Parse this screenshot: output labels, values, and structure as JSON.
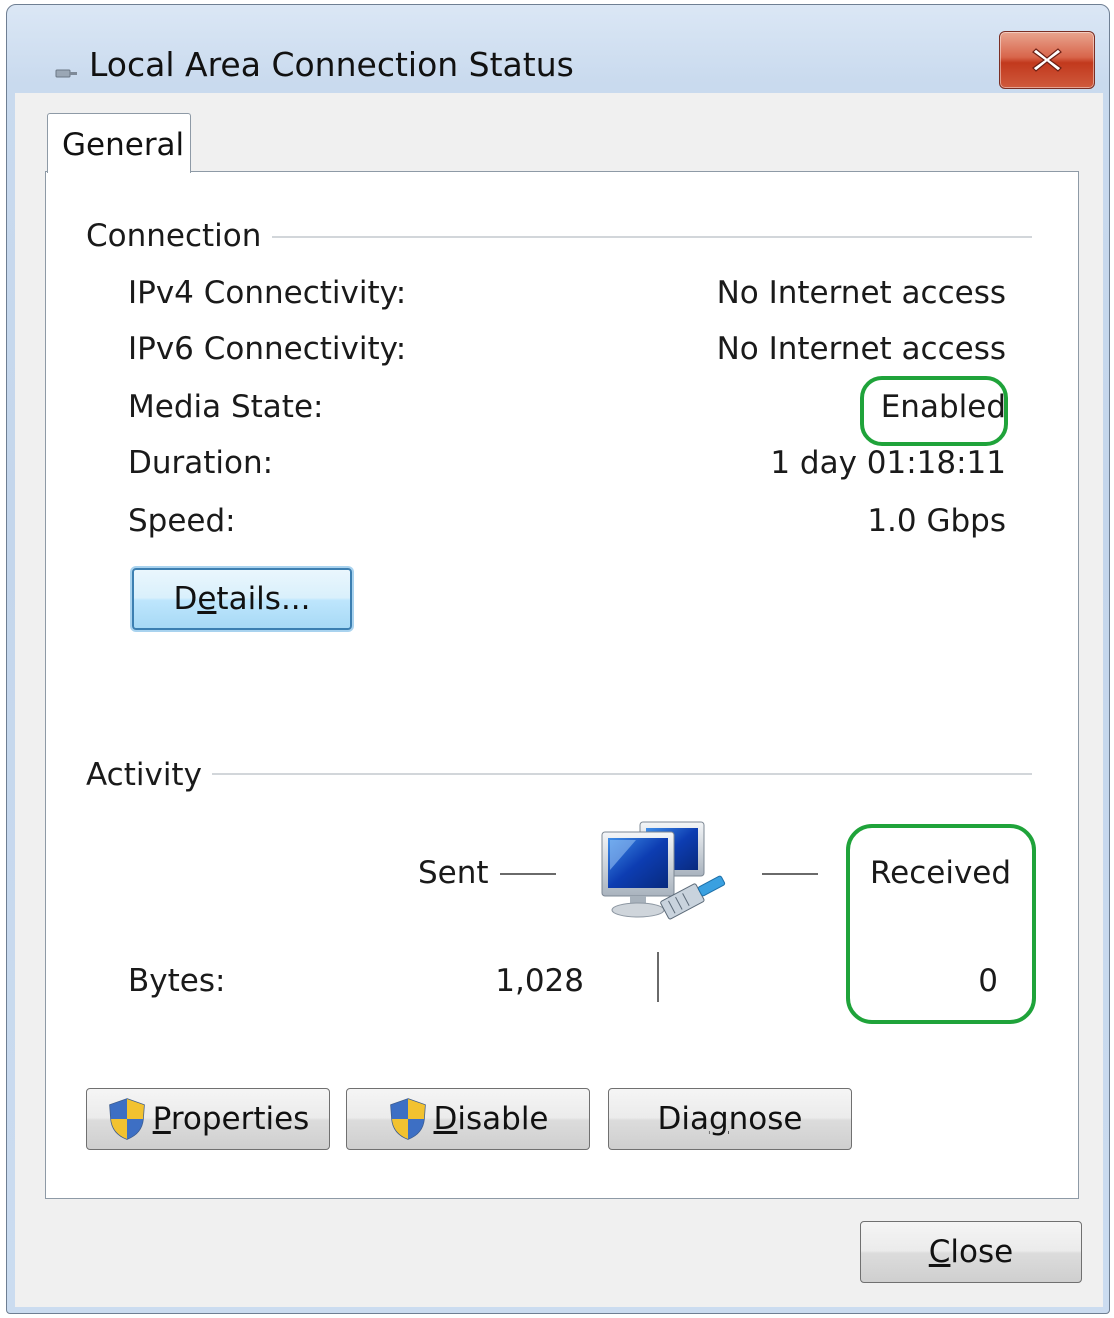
{
  "window": {
    "title": "Local Area Connection Status",
    "close_symbol": "✕"
  },
  "tabs": [
    {
      "label": "General",
      "selected": true
    }
  ],
  "connection": {
    "heading": "Connection",
    "rows": [
      {
        "label": "IPv4 Connectivity:",
        "value": "No Internet access"
      },
      {
        "label": "IPv6 Connectivity:",
        "value": "No Internet access"
      },
      {
        "label": "Media State:",
        "value": "Enabled"
      },
      {
        "label": "Duration:",
        "value": "1 day 01:18:11"
      },
      {
        "label": "Speed:",
        "value": "1.0 Gbps"
      }
    ],
    "details_button": {
      "pre": "D",
      "mnemonic": "e",
      "post": "tails..."
    }
  },
  "activity": {
    "heading": "Activity",
    "sent_label": "Sent",
    "received_label": "Received",
    "bytes_label": "Bytes:",
    "bytes_sent": "1,028",
    "bytes_received": "0",
    "icon": "network-computers-icon"
  },
  "buttons": {
    "properties": {
      "mnemonic": "P",
      "rest": "roperties"
    },
    "disable": {
      "mnemonic": "D",
      "rest": "isable"
    },
    "diagnose": {
      "pre": "Dia",
      "mnemonic": "g",
      "post": "nose"
    },
    "close": {
      "mnemonic": "C",
      "rest": "lose"
    }
  },
  "annotations": {
    "highlight_color": "#1fa33a",
    "highlighted": [
      "Media State value",
      "Received column"
    ]
  },
  "colors": {
    "titlebar": "#c4d6ec",
    "client_background": "#f0f0f0",
    "panel_background": "#ffffff",
    "close_button_red": "#c2391d",
    "focus_blue": "#3c7fb1"
  }
}
